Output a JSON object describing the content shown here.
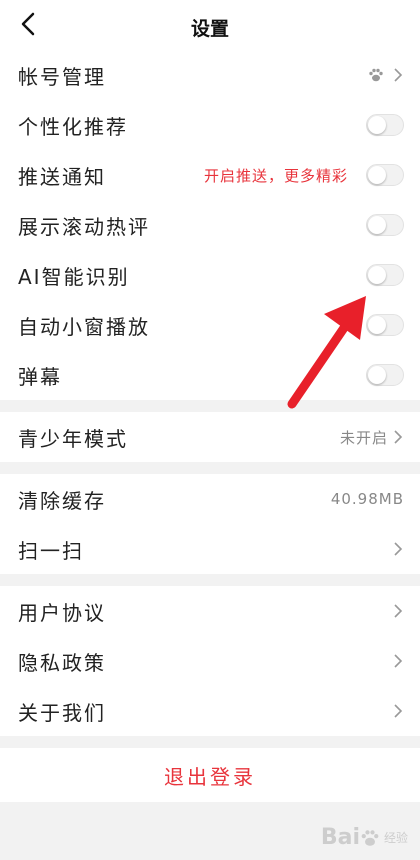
{
  "header": {
    "title": "设置"
  },
  "group1": {
    "account": {
      "label": "帐号管理"
    },
    "personal": {
      "label": "个性化推荐"
    },
    "push": {
      "label": "推送通知",
      "note": "开启推送，更多精彩"
    },
    "hotcomments": {
      "label": "展示滚动热评"
    },
    "ai": {
      "label": "AI智能识别"
    },
    "pip": {
      "label": "自动小窗播放"
    },
    "danmaku": {
      "label": "弹幕"
    }
  },
  "group2": {
    "teen": {
      "label": "青少年模式",
      "value": "未开启"
    }
  },
  "group3": {
    "cache": {
      "label": "清除缓存",
      "value": "40.98MB"
    },
    "scan": {
      "label": "扫一扫"
    }
  },
  "group4": {
    "agreement": {
      "label": "用户协议"
    },
    "privacy": {
      "label": "隐私政策"
    },
    "about": {
      "label": "关于我们"
    }
  },
  "logout": {
    "label": "退出登录"
  },
  "watermark": {
    "text": "Bai",
    "sub": "经验"
  },
  "colors": {
    "accent": "#e8343c",
    "arrow": "#e8202a"
  },
  "icons": {
    "back": "chevron-left-icon",
    "paw": "paw-icon",
    "chevron": "chevron-right-icon"
  }
}
